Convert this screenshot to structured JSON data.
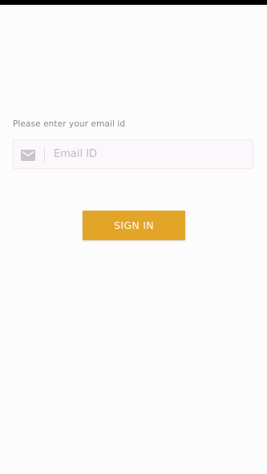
{
  "colors": {
    "background": "#fdfcfd",
    "status_bar": "#000000",
    "accent": "#e3a527",
    "label_text": "#8a8a8a",
    "placeholder_text": "#bdbabd",
    "icon": "#c9c6c9"
  },
  "login": {
    "prompt_label": "Please enter your email id",
    "email": {
      "icon": "mail-icon",
      "value": "",
      "placeholder": "Email ID"
    },
    "signin_label": "SIGN IN"
  }
}
